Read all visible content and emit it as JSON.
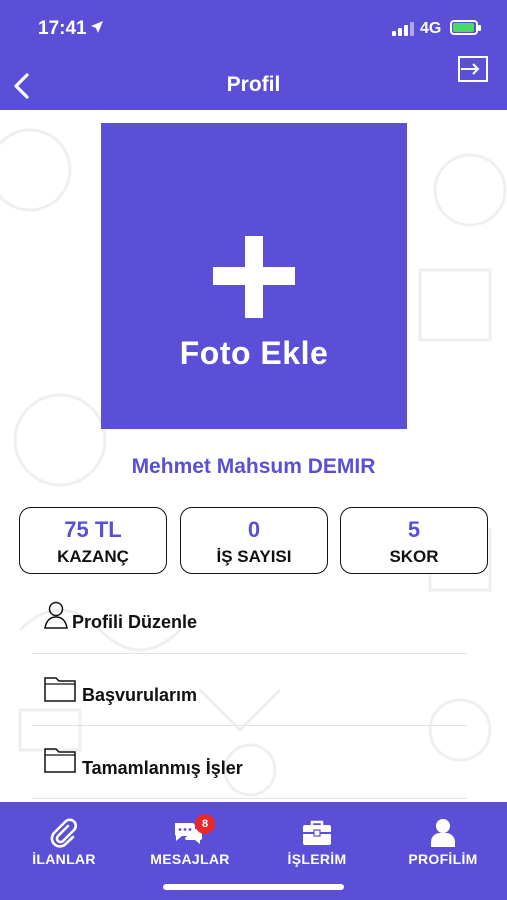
{
  "status_bar": {
    "time": "17:41",
    "network": "4G"
  },
  "header": {
    "title": "Profil",
    "back_icon": "chevron-left-icon",
    "exit_icon": "logout-icon"
  },
  "photo": {
    "label": "Foto Ekle",
    "icon": "plus-icon"
  },
  "user": {
    "name": "Mehmet Mahsum DEMIR"
  },
  "stats": [
    {
      "value": "75 TL",
      "label": "KAZANÇ"
    },
    {
      "value": "0",
      "label": "İŞ SAYISI"
    },
    {
      "value": "5",
      "label": "SKOR"
    }
  ],
  "menu": [
    {
      "label": "Profili Düzenle",
      "icon": "person-icon"
    },
    {
      "label": "Başvurularım",
      "icon": "folder-icon"
    },
    {
      "label": "Tamamlanmış İşler",
      "icon": "folder-icon"
    }
  ],
  "tabs": [
    {
      "label": "İLANLAR",
      "icon": "paperclip-icon"
    },
    {
      "label": "MESAJLAR",
      "icon": "chat-icon",
      "badge": "8"
    },
    {
      "label": "İŞLERİM",
      "icon": "briefcase-icon"
    },
    {
      "label": "PROFİLİM",
      "icon": "user-icon"
    }
  ],
  "colors": {
    "primary": "#5a4fd6",
    "badge": "#e8282b",
    "battery": "#4cd964"
  }
}
